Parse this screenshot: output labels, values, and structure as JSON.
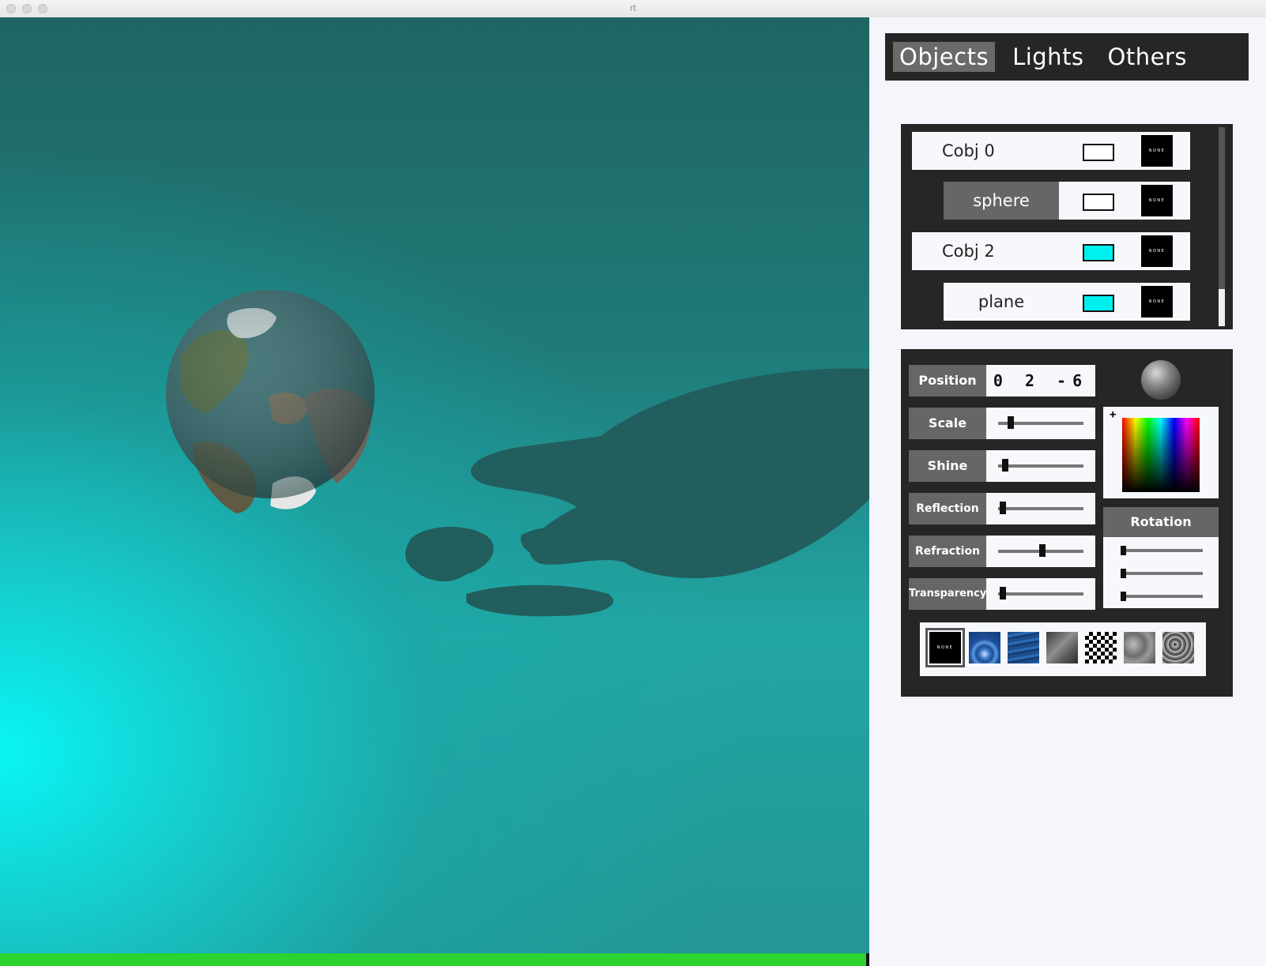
{
  "window": {
    "title": "rt"
  },
  "tabs": [
    {
      "label": "Objects",
      "active": true
    },
    {
      "label": "Lights",
      "active": false
    },
    {
      "label": "Others",
      "active": false
    }
  ],
  "objects": [
    {
      "label": "Cobj 0",
      "color": "#ffffff",
      "texture": "NONE",
      "selected": false,
      "child": false
    },
    {
      "label": "sphere",
      "color": "#ffffff",
      "texture": "NONE",
      "selected": true,
      "child": true
    },
    {
      "label": "Cobj 2",
      "color": "#00f0f0",
      "texture": "NONE",
      "selected": false,
      "child": false
    },
    {
      "label": "plane",
      "color": "#00f0f0",
      "texture": "NONE",
      "selected": false,
      "child": true
    }
  ],
  "properties": {
    "position": {
      "label": "Position",
      "value": "0 2 -6"
    },
    "sliders": [
      {
        "label": "Scale",
        "value": 0.12
      },
      {
        "label": "Shine",
        "value": 0.05
      },
      {
        "label": "Reflection",
        "value": 0.02
      },
      {
        "label": "Refraction",
        "value": 0.52
      },
      {
        "label": "Transparency",
        "value": 0.02
      }
    ],
    "rotation": {
      "label": "Rotation",
      "values": [
        0.0,
        0.0,
        0.0
      ]
    },
    "picker_cursor": "+"
  },
  "textures": [
    {
      "name": "none",
      "label": "NONE",
      "selected": true
    },
    {
      "name": "water-ripple",
      "selected": false
    },
    {
      "name": "water-waves",
      "selected": false
    },
    {
      "name": "metal",
      "selected": false
    },
    {
      "name": "checkerboard",
      "selected": false
    },
    {
      "name": "perlin-noise",
      "selected": false
    },
    {
      "name": "marble-noise",
      "selected": false
    }
  ],
  "render": {
    "progress": 1.0,
    "colors": {
      "sky_top": "#1f6462",
      "sky_glow": "#0af5f5",
      "shadow": "#205c5c",
      "progress": "#2bd42f"
    }
  }
}
